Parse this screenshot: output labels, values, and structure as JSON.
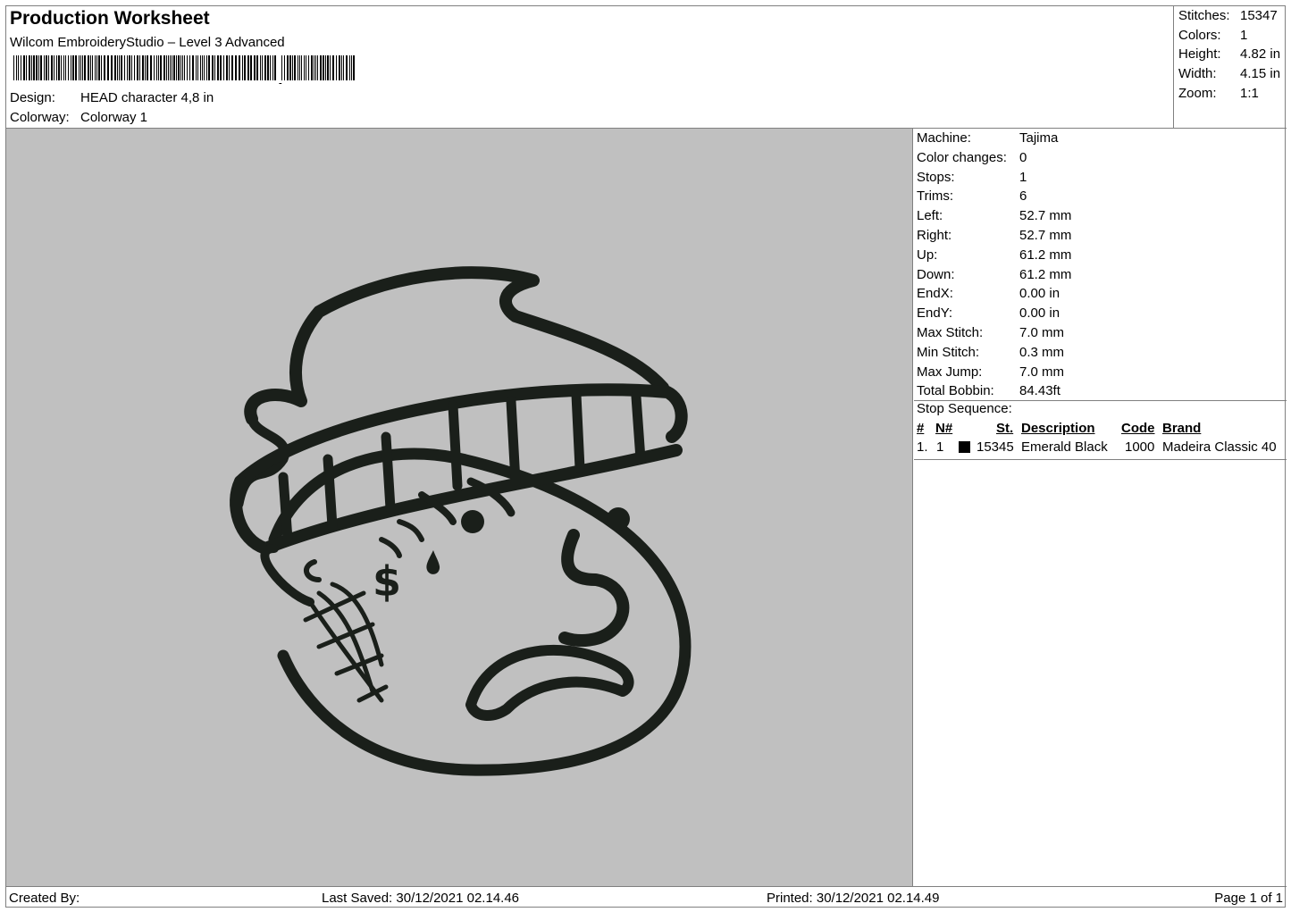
{
  "header": {
    "title": "Production Worksheet",
    "software": "Wilcom EmbroideryStudio – Level 3 Advanced",
    "design_label": "Design:",
    "design_value": "HEAD character 4,8 in",
    "colorway_label": "Colorway:",
    "colorway_value": "Colorway 1"
  },
  "summary": [
    {
      "label": "Stitches:",
      "value": "15347"
    },
    {
      "label": "Colors:",
      "value": "1"
    },
    {
      "label": "Height:",
      "value": "4.82 in"
    },
    {
      "label": "Width:",
      "value": "4.15 in"
    },
    {
      "label": "Zoom:",
      "value": "1:1"
    }
  ],
  "machine_info": [
    {
      "label": "Machine:",
      "value": "Tajima"
    },
    {
      "label": "Color changes:",
      "value": "0"
    },
    {
      "label": "Stops:",
      "value": "1"
    },
    {
      "label": "Trims:",
      "value": "6"
    },
    {
      "label": "Left:",
      "value": "52.7 mm"
    },
    {
      "label": "Right:",
      "value": "52.7 mm"
    },
    {
      "label": "Up:",
      "value": "61.2 mm"
    },
    {
      "label": "Down:",
      "value": "61.2 mm"
    },
    {
      "label": "EndX:",
      "value": "0.00 in"
    },
    {
      "label": "EndY:",
      "value": "0.00 in"
    },
    {
      "label": "Max Stitch:",
      "value": "7.0 mm"
    },
    {
      "label": "Min Stitch:",
      "value": "0.3 mm"
    },
    {
      "label": "Max Jump:",
      "value": "7.0 mm"
    },
    {
      "label": "Total Bobbin:",
      "value": "84.43ft"
    }
  ],
  "stop_sequence": {
    "title": "Stop Sequence:",
    "columns": [
      "#",
      "N#",
      "St.",
      "Description",
      "Code",
      "Brand"
    ],
    "rows": [
      {
        "num": "1.",
        "n": "1",
        "swatch": "#000000",
        "stitches": "15345",
        "description": "Emerald Black",
        "code": "1000",
        "brand": "Madeira Classic 40"
      }
    ]
  },
  "footer": {
    "created_by": "Created By:",
    "last_saved": "Last Saved: 30/12/2021 02.14.46",
    "printed": "Printed: 30/12/2021 02.14.49",
    "page": "Page 1 of 1"
  },
  "colors": {
    "canvas_bg": "#c0c0c0",
    "thread": "#1a1f1a"
  },
  "icons": {
    "barcode": "barcode-icon",
    "design": "embroidery-head-character-icon"
  }
}
